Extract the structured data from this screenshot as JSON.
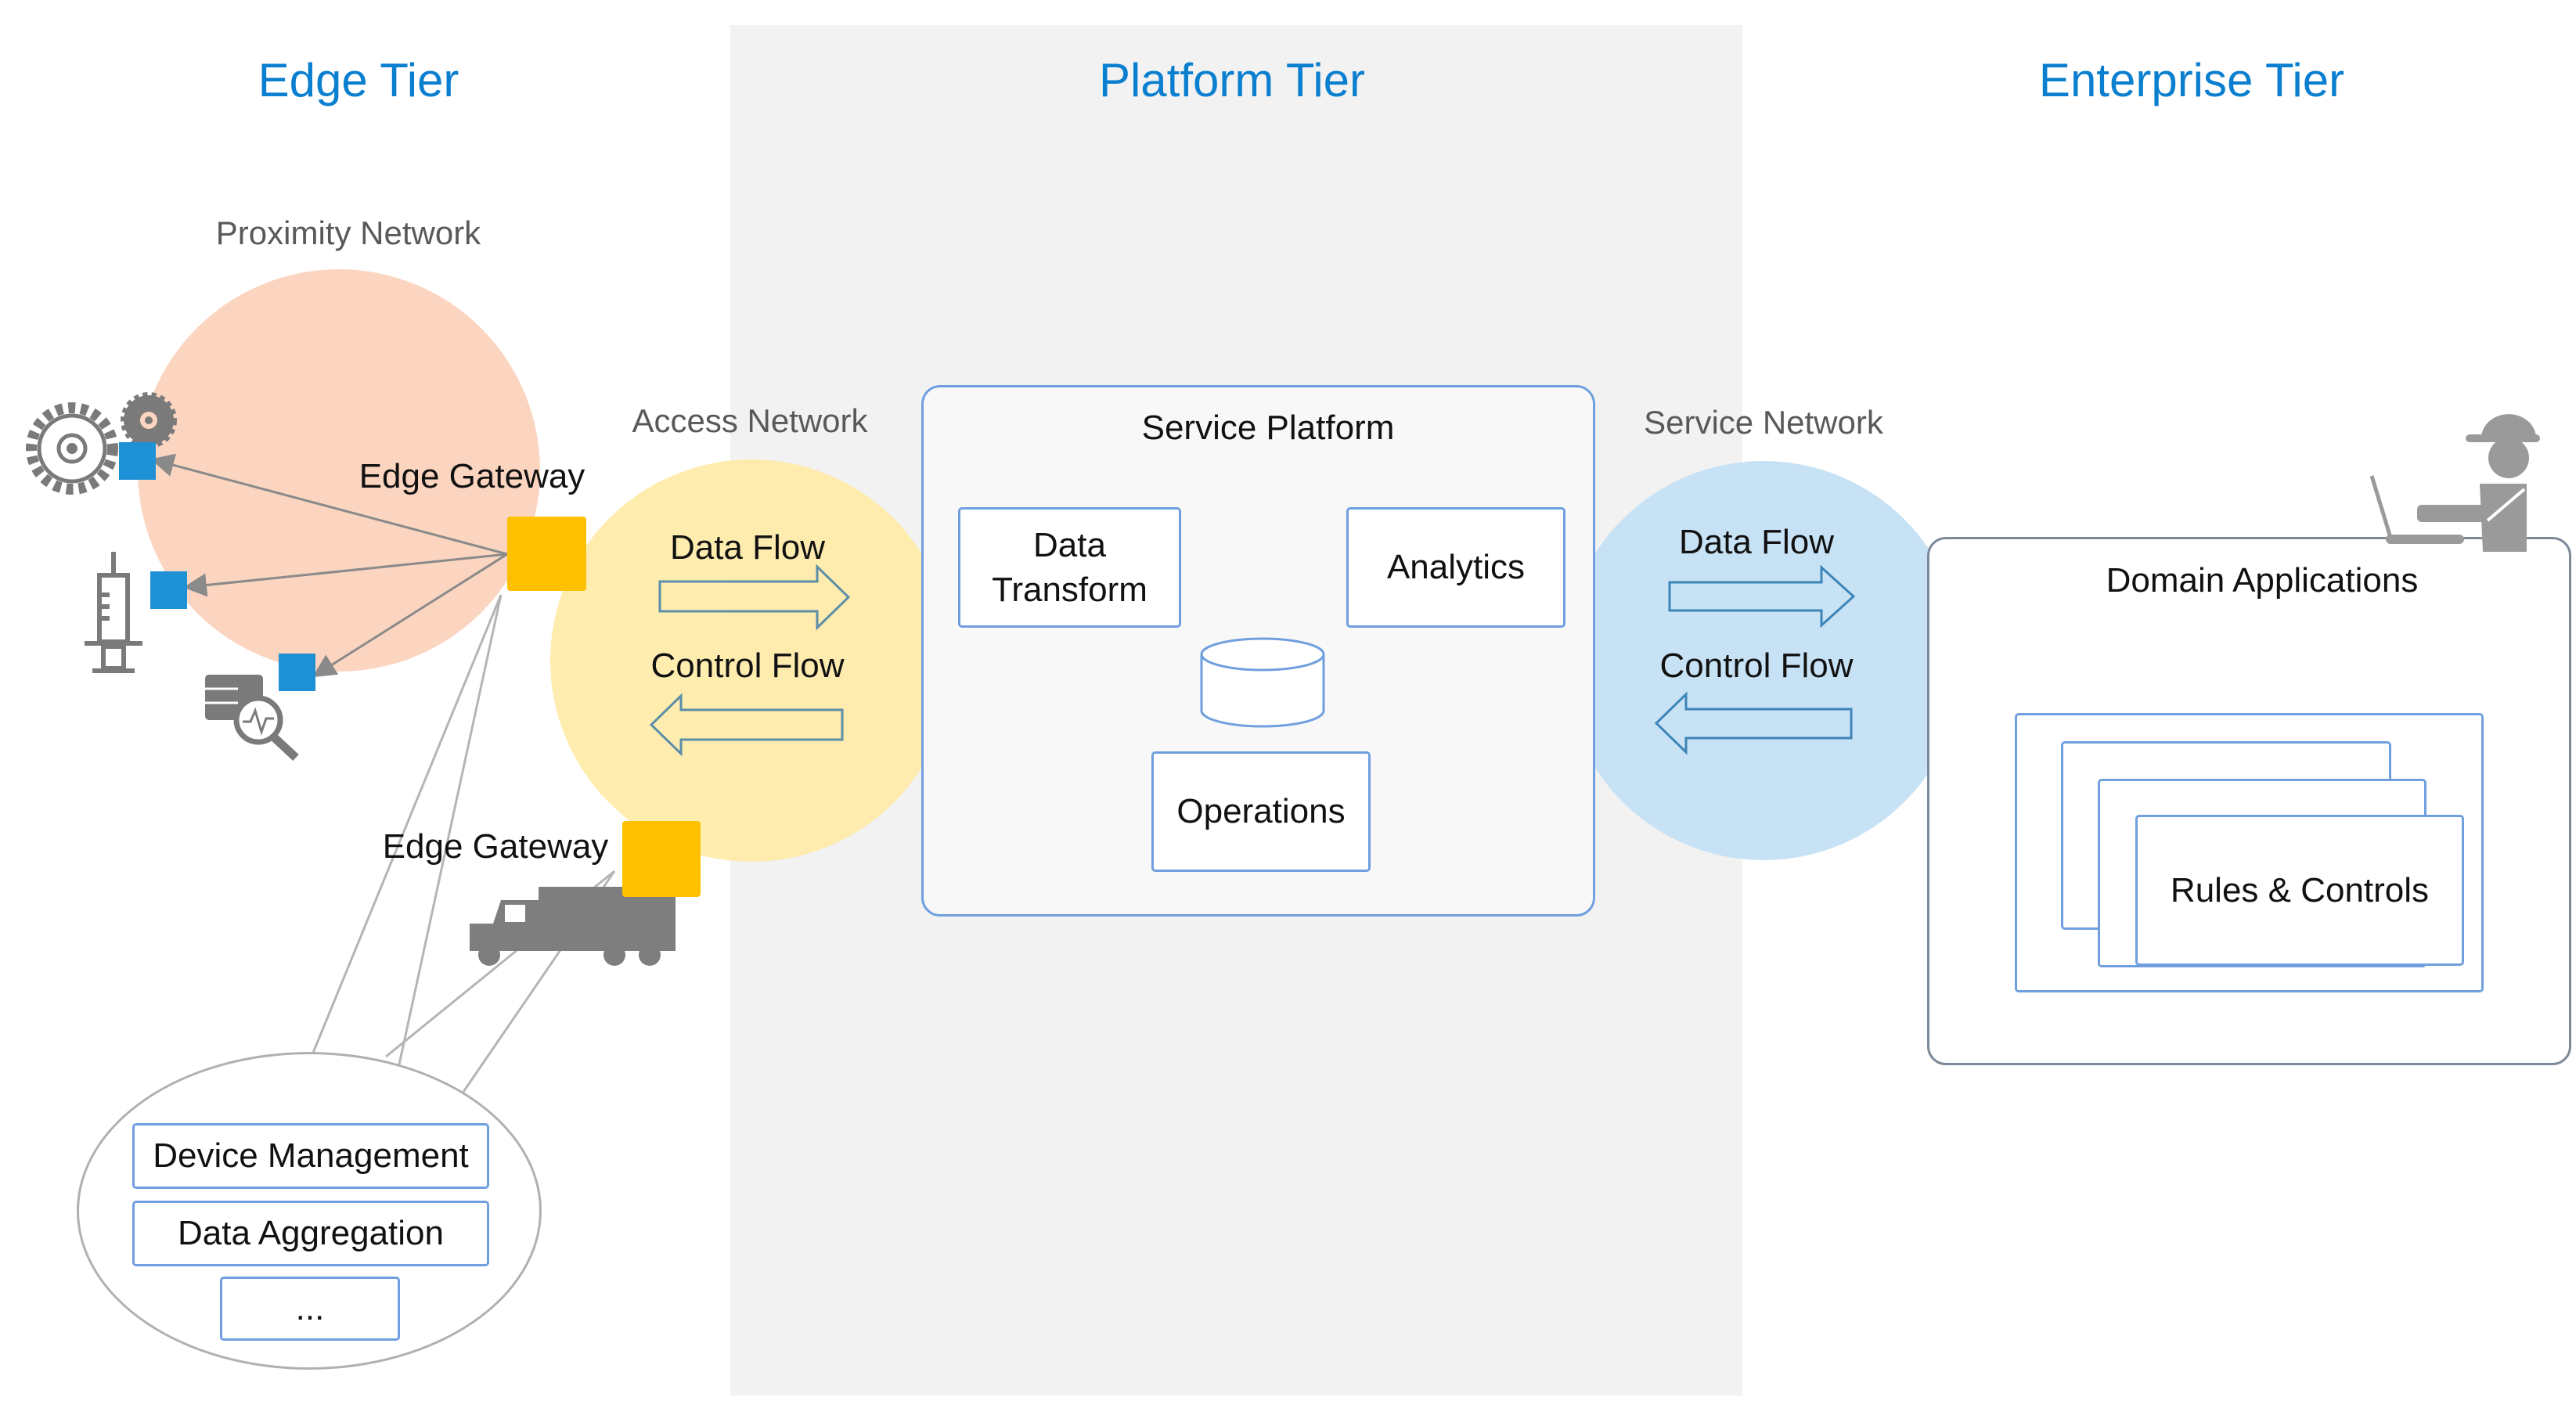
{
  "tiers": {
    "edge": "Edge Tier",
    "platform": "Platform Tier",
    "enterprise": "Enterprise Tier"
  },
  "networks": {
    "proximity": "Proximity Network",
    "access": "Access Network",
    "service": "Service Network"
  },
  "edge": {
    "gateway_1_label": "Edge Gateway",
    "gateway_2_label": "Edge Gateway",
    "devices": [
      "gear-machinery-icon",
      "syringe-icon",
      "data-analysis-icon",
      "truck-icon"
    ],
    "gateway_functions": [
      "Device Management",
      "Data Aggregation",
      "..."
    ]
  },
  "access_network": {
    "data_flow": "Data Flow",
    "control_flow": "Control Flow"
  },
  "service_platform": {
    "title": "Service Platform",
    "data_transform": "Data\nTransform",
    "analytics": "Analytics",
    "operations": "Operations",
    "storage_icon": "database-icon"
  },
  "service_network": {
    "data_flow": "Data Flow",
    "control_flow": "Control Flow"
  },
  "enterprise": {
    "domain_applications": "Domain Applications",
    "rules_controls": "Rules & Controls",
    "user_icon": "worker-at-laptop-icon"
  },
  "colors": {
    "tier_title": "#0a7fd0",
    "gateway": "#ffc000",
    "sensor": "#1e90d6",
    "proximity_circle": "#fcd5c0",
    "access_circle": "#ffeaa8",
    "service_circle": "#c5e0f4",
    "platform_panel": "#f2f2f2",
    "box_border": "#6f9fde"
  }
}
